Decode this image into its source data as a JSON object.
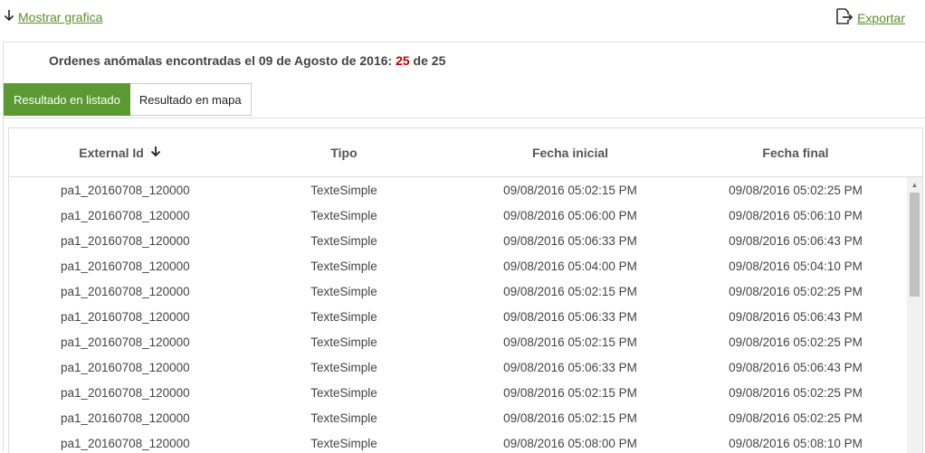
{
  "toolbar": {
    "show_chart_label": "Mostrar grafica",
    "export_label": "Exportar"
  },
  "summary": {
    "prefix": "Ordenes anómalas encontradas el 09 de Agosto de 2016: ",
    "found": "25",
    "middle": " de ",
    "total": "25"
  },
  "tabs": [
    {
      "label": "Resultado en listado",
      "active": true
    },
    {
      "label": "Resultado en mapa",
      "active": false
    }
  ],
  "table": {
    "headers": [
      "External Id",
      "Tipo",
      "Fecha inicial",
      "Fecha final"
    ],
    "rows": [
      [
        "pa1_20160708_120000",
        "TexteSimple",
        "09/08/2016 05:02:15 PM",
        "09/08/2016 05:02:25 PM"
      ],
      [
        "pa1_20160708_120000",
        "TexteSimple",
        "09/08/2016 05:06:00 PM",
        "09/08/2016 05:06:10 PM"
      ],
      [
        "pa1_20160708_120000",
        "TexteSimple",
        "09/08/2016 05:06:33 PM",
        "09/08/2016 05:06:43 PM"
      ],
      [
        "pa1_20160708_120000",
        "TexteSimple",
        "09/08/2016 05:04:00 PM",
        "09/08/2016 05:04:10 PM"
      ],
      [
        "pa1_20160708_120000",
        "TexteSimple",
        "09/08/2016 05:02:15 PM",
        "09/08/2016 05:02:25 PM"
      ],
      [
        "pa1_20160708_120000",
        "TexteSimple",
        "09/08/2016 05:06:33 PM",
        "09/08/2016 05:06:43 PM"
      ],
      [
        "pa1_20160708_120000",
        "TexteSimple",
        "09/08/2016 05:02:15 PM",
        "09/08/2016 05:02:25 PM"
      ],
      [
        "pa1_20160708_120000",
        "TexteSimple",
        "09/08/2016 05:06:33 PM",
        "09/08/2016 05:06:43 PM"
      ],
      [
        "pa1_20160708_120000",
        "TexteSimple",
        "09/08/2016 05:02:15 PM",
        "09/08/2016 05:02:25 PM"
      ],
      [
        "pa1_20160708_120000",
        "TexteSimple",
        "09/08/2016 05:02:15 PM",
        "09/08/2016 05:02:25 PM"
      ],
      [
        "pa1_20160708_120000",
        "TexteSimple",
        "09/08/2016 05:08:00 PM",
        "09/08/2016 05:08:10 PM"
      ]
    ]
  },
  "icons": {
    "show_chart": "arrow-down-icon",
    "export": "export-icon",
    "sort": "sort-desc-icon",
    "scroll_up": "scroll-up-icon"
  },
  "colors": {
    "accent": "#5b9a33",
    "link": "#5b8f29",
    "highlight": "#c00000"
  }
}
